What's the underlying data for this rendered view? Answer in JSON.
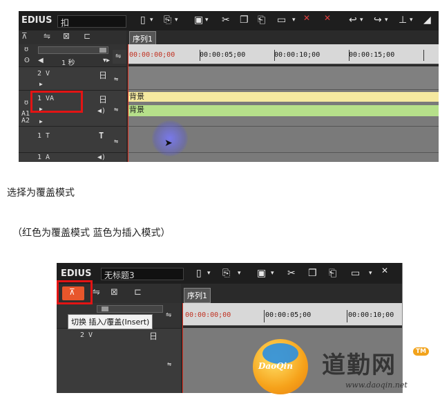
{
  "shot1": {
    "app_logo": "EDIUS",
    "project_name": "扣",
    "sequence_tab": "序列1",
    "scale_label": "1 秒",
    "ruler_timecodes": [
      "00:00:00;00",
      "00:00:05;00",
      "00:00:10;00",
      "00:00:15;00"
    ],
    "tracks": [
      {
        "name": "2 V",
        "icon": "日"
      },
      {
        "name": "1 VA",
        "icon": "日",
        "sub": "◀)"
      },
      {
        "name": "1 T",
        "icon": "T"
      },
      {
        "name": "1 A",
        "icon": "◀)"
      }
    ],
    "side_labels": [
      "A1",
      "A2"
    ],
    "clips": [
      {
        "label": "背景",
        "color": "#f5e9a0"
      },
      {
        "label": "背景",
        "color": "#b6e08a"
      }
    ]
  },
  "caption1": "选择为覆盖模式",
  "caption2": "（红色为覆盖模式 蓝色为插入模式）",
  "shot2": {
    "app_logo": "EDIUS",
    "project_name": "无标题3",
    "sequence_tab": "序列1",
    "ruler_timecodes": [
      "00:00:00;00",
      "00:00:05;00",
      "00:00:10;00"
    ],
    "tooltip": "切换 插入/覆盖(Insert)",
    "tracks": [
      {
        "name": "2 V",
        "icon": "日"
      }
    ],
    "mode_button_color": "#e8562b"
  },
  "watermark": {
    "badge_text": "DaoQin",
    "brand_text": "道勤网",
    "tm": "TM",
    "url": "www.daoqin.net"
  }
}
